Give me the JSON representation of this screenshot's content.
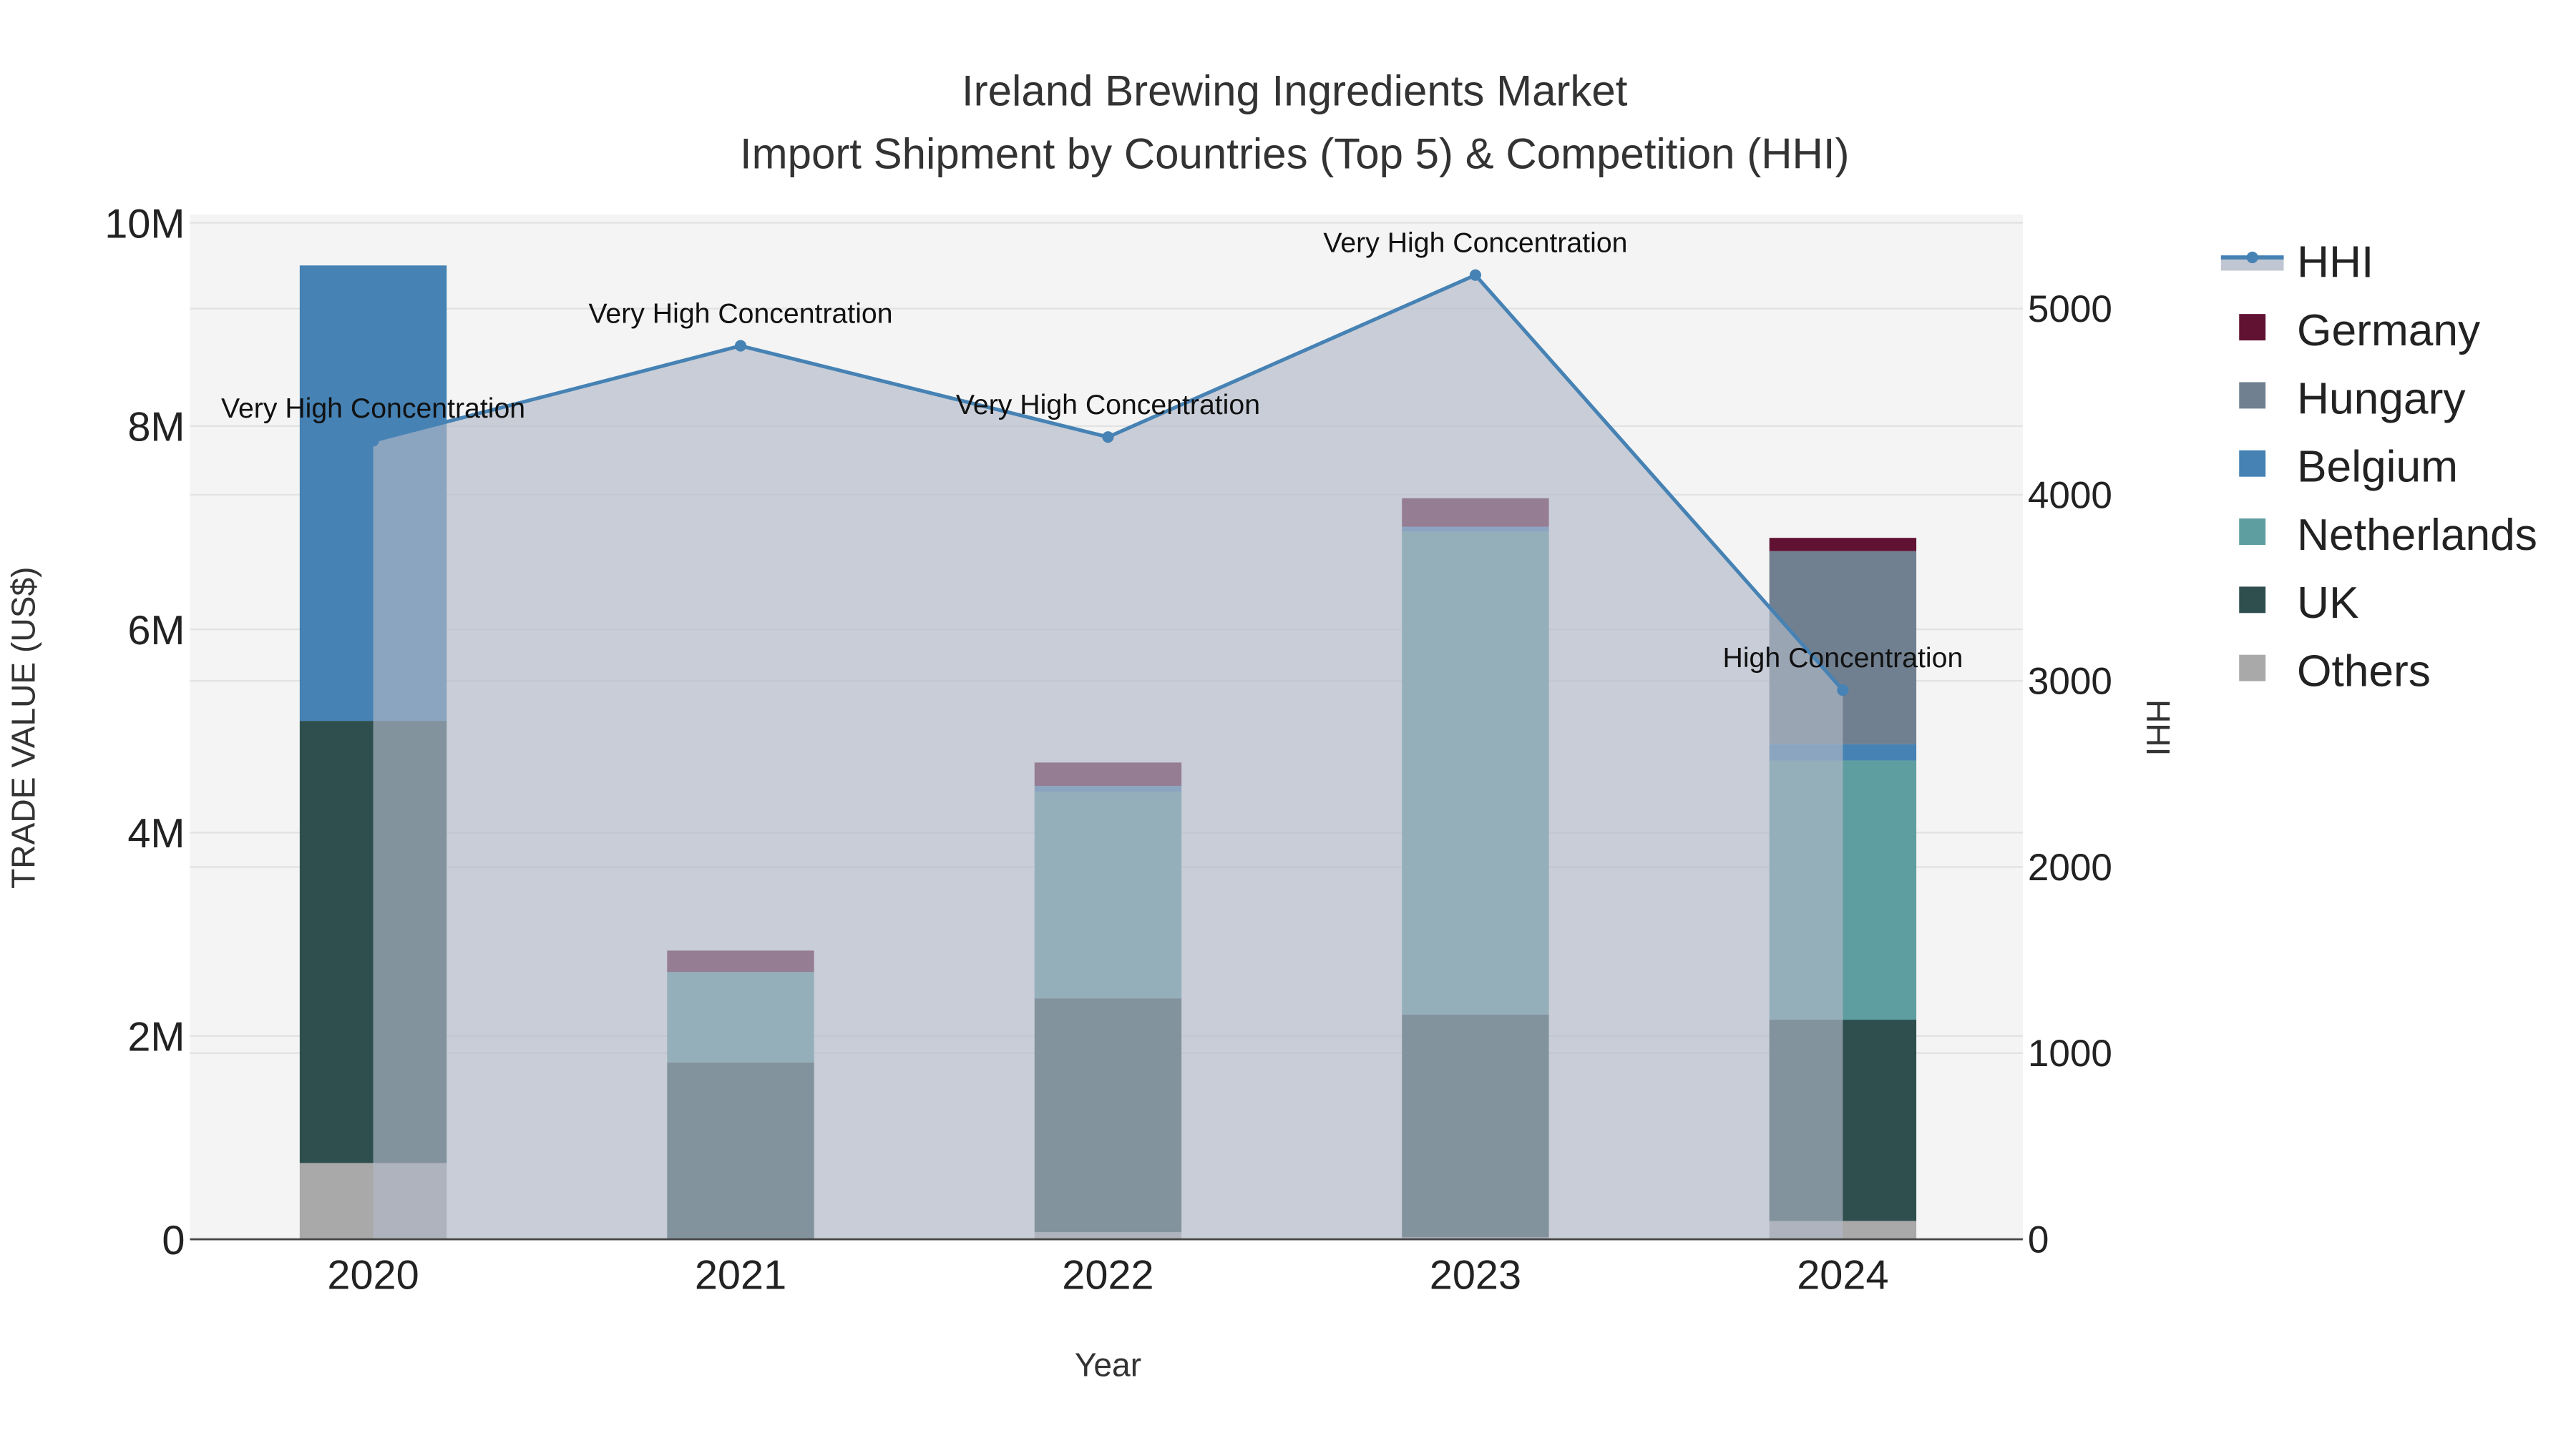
{
  "chart_data": {
    "type": "bar",
    "title_line1": "Ireland Brewing Ingredients Market",
    "title_line2": "Import Shipment by Countries (Top 5) & Competition (HHI)",
    "xlabel": "Year",
    "ylabel": "TRADE VALUE (US$)",
    "y2label": "HHI",
    "categories": [
      "2020",
      "2021",
      "2022",
      "2023",
      "2024"
    ],
    "ylim": [
      0,
      10000000
    ],
    "y2lim": [
      0,
      5500
    ],
    "yticks": [
      {
        "v": 0,
        "label": "0"
      },
      {
        "v": 2000000,
        "label": "2M"
      },
      {
        "v": 4000000,
        "label": "4M"
      },
      {
        "v": 6000000,
        "label": "6M"
      },
      {
        "v": 8000000,
        "label": "8M"
      },
      {
        "v": 10000000,
        "label": "10M"
      }
    ],
    "y2ticks": [
      {
        "v": 0,
        "label": "0"
      },
      {
        "v": 1000,
        "label": "1000"
      },
      {
        "v": 2000,
        "label": "2000"
      },
      {
        "v": 3000,
        "label": "3000"
      },
      {
        "v": 4000,
        "label": "4000"
      },
      {
        "v": 5000,
        "label": "5000"
      }
    ],
    "series": [
      {
        "name": "Others",
        "color": "#a9a9a9",
        "values": [
          750000,
          0,
          70000,
          20000,
          180000
        ]
      },
      {
        "name": "UK",
        "color": "#2f4f4f",
        "values": [
          4350000,
          1740000,
          2300000,
          2190000,
          1980000
        ]
      },
      {
        "name": "Netherlands",
        "color": "#5f9ea0",
        "values": [
          0,
          890000,
          2030000,
          4750000,
          2550000
        ]
      },
      {
        "name": "Belgium",
        "color": "#4682b4",
        "values": [
          4480000,
          0,
          60000,
          50000,
          160000
        ]
      },
      {
        "name": "Hungary",
        "color": "#708090",
        "values": [
          0,
          0,
          0,
          0,
          1900000
        ]
      },
      {
        "name": "Germany",
        "color": "#611132",
        "values": [
          0,
          210000,
          230000,
          280000,
          130000
        ]
      }
    ],
    "hhi": {
      "name": "HHI",
      "color": "#4682b4",
      "values": [
        4290,
        4800,
        4310,
        5180,
        2950
      ],
      "annotations": [
        "Very High Concentration",
        "Very High Concentration",
        "Very High Concentration",
        "Very High Concentration",
        "High Concentration"
      ]
    },
    "legend": [
      "HHI",
      "Germany",
      "Hungary",
      "Belgium",
      "Netherlands",
      "UK",
      "Others"
    ],
    "legend_position": "right"
  }
}
